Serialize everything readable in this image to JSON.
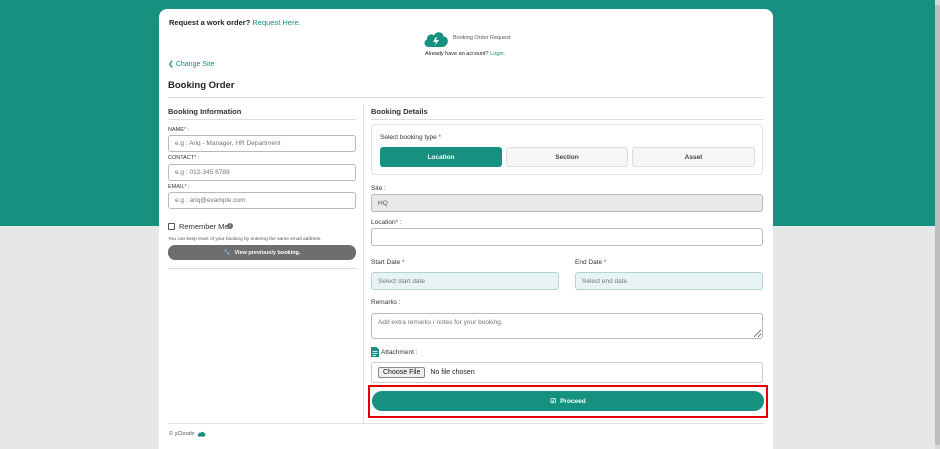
{
  "header": {
    "request_prompt": "Request a work order?",
    "request_link": "Request Here.",
    "brand_text": "Booking Order Request",
    "account_prompt": "Already have an account?",
    "login_link": "Login."
  },
  "nav": {
    "change_site": "Change Site"
  },
  "page_title": "Booking Order",
  "booking_info": {
    "heading": "Booking Information",
    "name_label": "NAME",
    "name_placeholder": "e.g : Ariq - Manager, HR Department",
    "contact_label": "CONTACT",
    "contact_placeholder": "e.g : 012-345 6789",
    "email_label": "EMAIL",
    "email_placeholder": "e.g : ariq@example.com",
    "remember_label": "Remember Me",
    "remember_hint": "You can keep track of your booking by entering the same email address.",
    "view_button": "View previously booking."
  },
  "booking_details": {
    "heading": "Booking Details",
    "type_label": "Select booking type",
    "types": [
      "Location",
      "Section",
      "Asset"
    ],
    "site_label": "Site :",
    "site_value": "HQ",
    "location_label": "Location",
    "start_label": "Start Date",
    "start_placeholder": "Select start date",
    "end_label": "End Date",
    "end_placeholder": "Select end date",
    "remarks_label": "Remarks :",
    "remarks_placeholder": "Add extra remarks / notes for your booking.",
    "attachment_label": "Attachment :",
    "choose_file": "Choose File",
    "no_file": "No file chosen",
    "proceed_button": "Proceed"
  },
  "footer": {
    "text": "© yCloudx"
  },
  "colors": {
    "accent": "#16907f",
    "highlight": "#e00000"
  }
}
